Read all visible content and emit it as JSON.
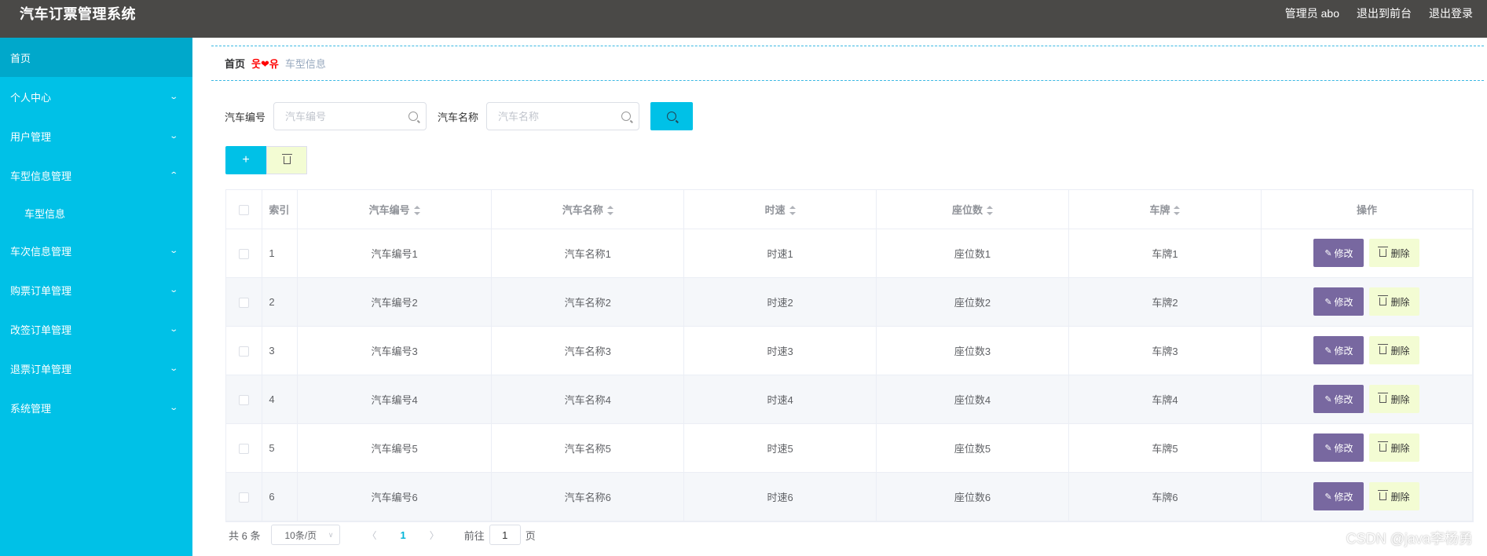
{
  "header": {
    "title": "汽车订票管理系统",
    "admin_label": "管理员 abo",
    "back_front": "退出到前台",
    "logout": "退出登录"
  },
  "sidebar": {
    "items": [
      {
        "label": "首页",
        "active": true,
        "expandable": false
      },
      {
        "label": "个人中心",
        "expandable": true,
        "expanded": false
      },
      {
        "label": "用户管理",
        "expandable": true,
        "expanded": false
      },
      {
        "label": "车型信息管理",
        "expandable": true,
        "expanded": true,
        "children": [
          {
            "label": "车型信息"
          }
        ]
      },
      {
        "label": "车次信息管理",
        "expandable": true,
        "expanded": false
      },
      {
        "label": "购票订单管理",
        "expandable": true,
        "expanded": false
      },
      {
        "label": "改签订单管理",
        "expandable": true,
        "expanded": false
      },
      {
        "label": "退票订单管理",
        "expandable": true,
        "expanded": false
      },
      {
        "label": "系统管理",
        "expandable": true,
        "expanded": false
      }
    ]
  },
  "breadcrumb": {
    "home": "首页",
    "separator": "웃❤유",
    "current": "车型信息"
  },
  "search": {
    "field1_label": "汽车编号",
    "field1_placeholder": "汽车编号",
    "field1_value": "",
    "field2_label": "汽车名称",
    "field2_placeholder": "汽车名称",
    "field2_value": ""
  },
  "table": {
    "headers": {
      "index": "索引",
      "car_no": "汽车编号",
      "car_name": "汽车名称",
      "speed": "时速",
      "seats": "座位数",
      "plate": "车牌",
      "ops": "操作"
    },
    "edit_label": "修改",
    "delete_label": "删除",
    "rows": [
      {
        "index": "1",
        "car_no": "汽车编号1",
        "car_name": "汽车名称1",
        "speed": "时速1",
        "seats": "座位数1",
        "plate": "车牌1"
      },
      {
        "index": "2",
        "car_no": "汽车编号2",
        "car_name": "汽车名称2",
        "speed": "时速2",
        "seats": "座位数2",
        "plate": "车牌2"
      },
      {
        "index": "3",
        "car_no": "汽车编号3",
        "car_name": "汽车名称3",
        "speed": "时速3",
        "seats": "座位数3",
        "plate": "车牌3"
      },
      {
        "index": "4",
        "car_no": "汽车编号4",
        "car_name": "汽车名称4",
        "speed": "时速4",
        "seats": "座位数4",
        "plate": "车牌4"
      },
      {
        "index": "5",
        "car_no": "汽车编号5",
        "car_name": "汽车名称5",
        "speed": "时速5",
        "seats": "座位数5",
        "plate": "车牌5"
      },
      {
        "index": "6",
        "car_no": "汽车编号6",
        "car_name": "汽车名称6",
        "speed": "时速6",
        "seats": "座位数6",
        "plate": "车牌6"
      }
    ]
  },
  "pagination": {
    "total": "共 6 条",
    "page_size": "10条/页",
    "current_page": "1",
    "goto_prefix": "前往",
    "goto_value": "1",
    "goto_suffix": "页"
  },
  "watermark": "CSDN @java李杨勇",
  "colors": {
    "sidebar": "#00c1e7",
    "header": "#4a4947",
    "edit_button": "#7868a0",
    "delete_button": "#f3fcd3"
  }
}
